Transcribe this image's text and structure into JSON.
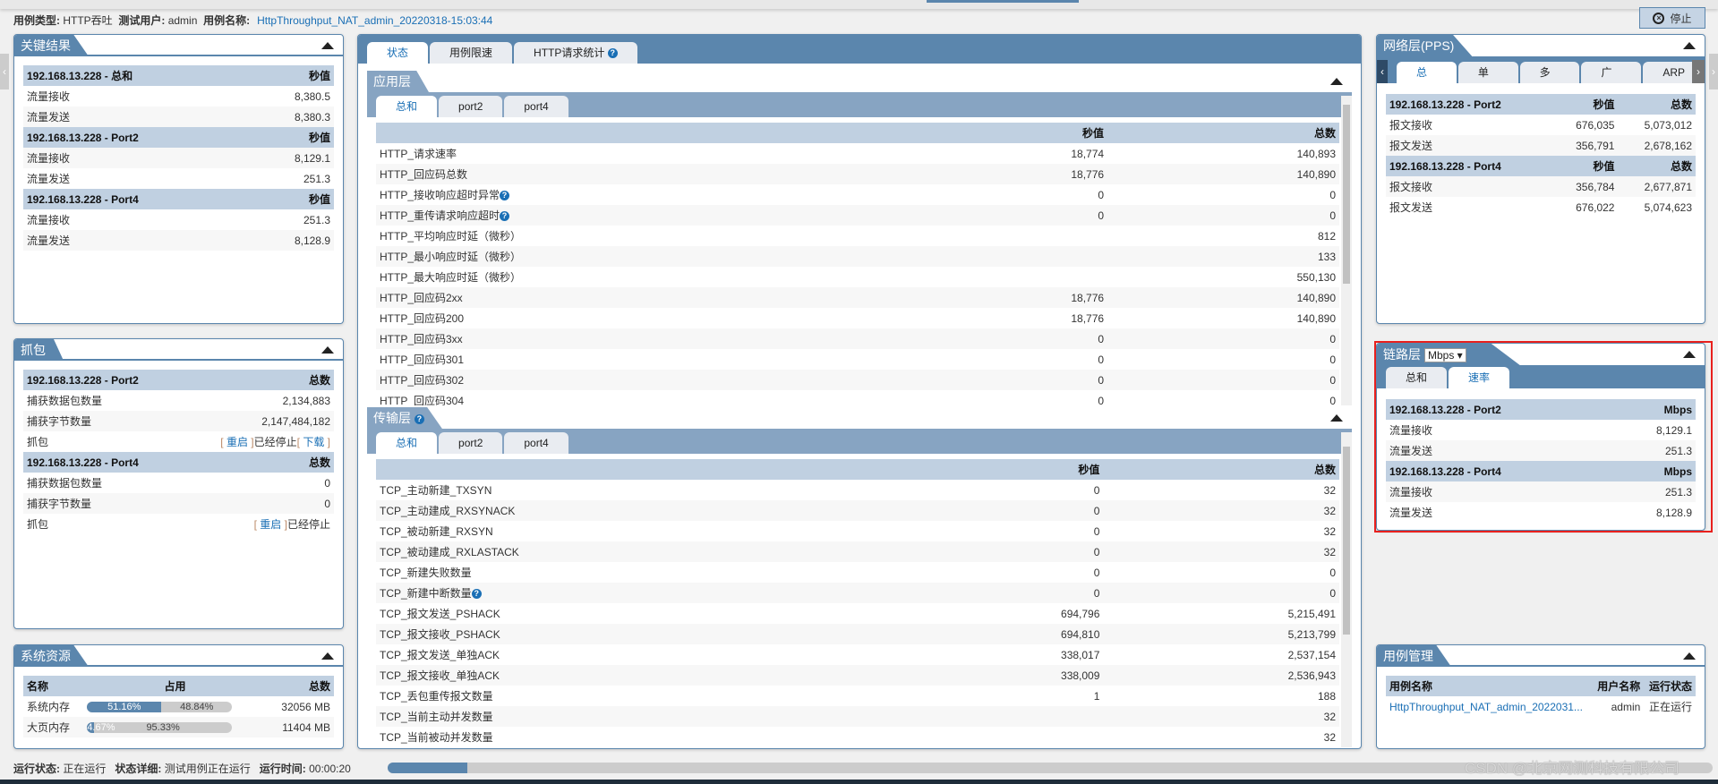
{
  "header": {
    "case_type_label": "用例类型:",
    "case_type": "HTTP吞吐",
    "user_label": "测试用户:",
    "user": "admin",
    "case_name_label": "用例名称:",
    "case_name": "HttpThroughput_NAT_admin_20220318-15:03:44",
    "stop_label": "停止",
    "stop_icon": "stop-circle-icon"
  },
  "key_results": {
    "title": "关键结果",
    "groups": [
      {
        "name": "192.168.13.228 - 总和",
        "col": "秒值",
        "rows": [
          [
            "流量接收",
            "8,380.5"
          ],
          [
            "流量发送",
            "8,380.3"
          ]
        ]
      },
      {
        "name": "192.168.13.228 - Port2",
        "col": "秒值",
        "rows": [
          [
            "流量接收",
            "8,129.1"
          ],
          [
            "流量发送",
            "251.3"
          ]
        ]
      },
      {
        "name": "192.168.13.228 - Port4",
        "col": "秒值",
        "rows": [
          [
            "流量接收",
            "251.3"
          ],
          [
            "流量发送",
            "8,128.9"
          ]
        ]
      }
    ]
  },
  "capture": {
    "title": "抓包",
    "groups": [
      {
        "name": "192.168.13.228 - Port2",
        "col": "总数",
        "rows": [
          [
            "捕获数据包数量",
            "2,134,883"
          ],
          [
            "捕获字节数量",
            "2,147,484,182"
          ]
        ],
        "action": {
          "label": "抓包",
          "restart": "重启",
          "state": "已经停止",
          "download": "下载"
        }
      },
      {
        "name": "192.168.13.228 - Port4",
        "col": "总数",
        "rows": [
          [
            "捕获数据包数量",
            "0"
          ],
          [
            "捕获字节数量",
            "0"
          ]
        ],
        "action": {
          "label": "抓包",
          "restart": "重启",
          "state": "已经停止"
        }
      }
    ]
  },
  "sysres": {
    "title": "系统资源",
    "cols": [
      "名称",
      "占用",
      "总数"
    ],
    "rows": [
      {
        "name": "系统内存",
        "used": "51.16%",
        "free": "48.84%",
        "used_pct": 51.16,
        "total": "32056 MB"
      },
      {
        "name": "大页内存",
        "used": "4.67%",
        "free": "95.33%",
        "used_pct": 4.67,
        "total": "11404 MB"
      }
    ]
  },
  "center": {
    "tabs": [
      "状态",
      "用例限速",
      "HTTP请求统计"
    ],
    "active_tab": 0,
    "app": {
      "title": "应用层",
      "tabs": [
        "总和",
        "port2",
        "port4"
      ],
      "cols": [
        "",
        "秒值",
        "总数"
      ],
      "rows": [
        [
          "HTTP_请求速率",
          "18,774",
          "140,893"
        ],
        [
          "HTTP_回应码总数",
          "18,776",
          "140,890"
        ],
        [
          "HTTP_接收响应超时异常",
          "0",
          "0",
          true
        ],
        [
          "HTTP_重传请求响应超时",
          "0",
          "0",
          true
        ],
        [
          "HTTP_平均响应时延（微秒）",
          "",
          "812"
        ],
        [
          "HTTP_最小响应时延（微秒）",
          "",
          "133"
        ],
        [
          "HTTP_最大响应时延（微秒）",
          "",
          "550,130"
        ],
        [
          "HTTP_回应码2xx",
          "18,776",
          "140,890"
        ],
        [
          "HTTP_回应码200",
          "18,776",
          "140,890"
        ],
        [
          "HTTP_回应码3xx",
          "0",
          "0"
        ],
        [
          "HTTP_回应码301",
          "0",
          "0"
        ],
        [
          "HTTP_回应码302",
          "0",
          "0"
        ],
        [
          "HTTP_回应码304",
          "0",
          "0"
        ]
      ]
    },
    "transport": {
      "title": "传输层",
      "tabs": [
        "总和",
        "port2",
        "port4"
      ],
      "cols": [
        "",
        "秒值",
        "总数"
      ],
      "rows": [
        [
          "TCP_主动新建_TXSYN",
          "0",
          "32"
        ],
        [
          "TCP_主动建成_RXSYNACK",
          "0",
          "32"
        ],
        [
          "TCP_被动新建_RXSYN",
          "0",
          "32"
        ],
        [
          "TCP_被动建成_RXLASTACK",
          "0",
          "32"
        ],
        [
          "TCP_新建失败数量",
          "0",
          "0"
        ],
        [
          "TCP_新建中断数量",
          "0",
          "0",
          true
        ],
        [
          "TCP_报文发送_PSHACK",
          "694,796",
          "5,215,491"
        ],
        [
          "TCP_报文接收_PSHACK",
          "694,810",
          "5,213,799"
        ],
        [
          "TCP_报文发送_单独ACK",
          "338,017",
          "2,537,154"
        ],
        [
          "TCP_报文接收_单独ACK",
          "338,009",
          "2,536,943"
        ],
        [
          "TCP_丢包重传报文数量",
          "1",
          "188"
        ],
        [
          "TCP_当前主动并发数量",
          "",
          "32"
        ],
        [
          "TCP_当前被动并发数量",
          "",
          "32"
        ]
      ]
    }
  },
  "network": {
    "title": "网络层(PPS)",
    "tabs": [
      "总和",
      "单播",
      "多播",
      "广播",
      "ARP"
    ],
    "groups": [
      {
        "name": "192.168.13.228 - Port2",
        "cols": [
          "秒值",
          "总数"
        ],
        "rows": [
          [
            "报文接收",
            "676,035",
            "5,073,012"
          ],
          [
            "报文发送",
            "356,791",
            "2,678,162"
          ]
        ]
      },
      {
        "name": "192.168.13.228 - Port4",
        "cols": [
          "秒值",
          "总数"
        ],
        "rows": [
          [
            "报文接收",
            "356,784",
            "2,677,871"
          ],
          [
            "报文发送",
            "676,022",
            "5,074,623"
          ]
        ]
      }
    ]
  },
  "link": {
    "title": "链路层",
    "unit": "Mbps",
    "tabs": [
      "总和",
      "速率"
    ],
    "groups": [
      {
        "name": "192.168.13.228 - Port2",
        "col": "Mbps",
        "rows": [
          [
            "流量接收",
            "8,129.1"
          ],
          [
            "流量发送",
            "251.3"
          ]
        ]
      },
      {
        "name": "192.168.13.228 - Port4",
        "col": "Mbps",
        "rows": [
          [
            "流量接收",
            "251.3"
          ],
          [
            "流量发送",
            "8,128.9"
          ]
        ]
      }
    ]
  },
  "casemgmt": {
    "title": "用例管理",
    "cols": [
      "用例名称",
      "用户名称",
      "运行状态"
    ],
    "rows": [
      [
        "HttpThroughput_NAT_admin_2022031...",
        "admin",
        "正在运行"
      ]
    ]
  },
  "status": {
    "run_label": "运行状态:",
    "run": "正在运行",
    "detail_label": "状态详细:",
    "detail": "测试用例正在运行",
    "time_label": "运行时间:",
    "time": "00:00:20",
    "progress_pct": 6
  },
  "watermark": "CSDN @北京网测科技有限公司",
  "colors": {
    "accent": "#5b86ad",
    "header_row": "#c0d0e1",
    "link": "#1a6fb5",
    "highlight": "#e8201d"
  }
}
